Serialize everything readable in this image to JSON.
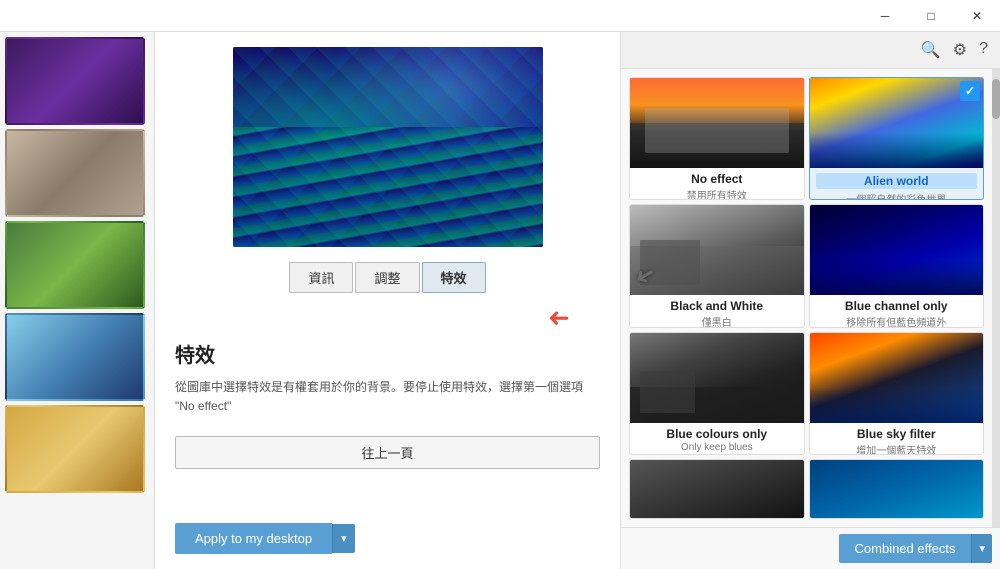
{
  "titlebar": {
    "minimize_label": "─",
    "maximize_label": "□",
    "close_label": "✕"
  },
  "toolbar": {
    "search_icon": "🔍",
    "gear_icon": "⚙",
    "help_icon": "?"
  },
  "sidebar": {
    "thumbs": [
      {
        "id": "thumb1",
        "label": "Thumbnail 1"
      },
      {
        "id": "thumb2",
        "label": "Thumbnail 2"
      },
      {
        "id": "thumb3",
        "label": "Thumbnail 3"
      },
      {
        "id": "thumb4",
        "label": "Thumbnail 4"
      },
      {
        "id": "thumb5",
        "label": "Thumbnail 5"
      }
    ]
  },
  "tabs": [
    {
      "id": "info",
      "label": "資訊"
    },
    {
      "id": "adjust",
      "label": "調整"
    },
    {
      "id": "effects",
      "label": "特效",
      "active": true
    }
  ],
  "section": {
    "title": "特效",
    "description": "從圖庫中選擇特效是有權套用於你的背景。要停止使用特效，選擇第一個選項 \"No effect\"",
    "back_button": "往上一頁"
  },
  "apply_button": {
    "label": "Apply to my desktop",
    "dropdown_icon": "▾"
  },
  "effects": [
    {
      "id": "no-effect",
      "name": "No effect",
      "desc": "禁用所有特效",
      "selected": false,
      "checked": false,
      "thumb_class": "et-noeffect"
    },
    {
      "id": "alien-world",
      "name": "Alien world",
      "desc": "一個超自然的彩色世界",
      "selected": true,
      "checked": true,
      "thumb_class": "et-alien"
    },
    {
      "id": "black-and-white",
      "name": "Black and White",
      "desc": "僅黑白",
      "selected": false,
      "checked": false,
      "thumb_class": "et-bw",
      "has_arrow": true
    },
    {
      "id": "blue-channel-only",
      "name": "Blue channel only",
      "desc": "移除所有但藍色頻道外",
      "selected": false,
      "checked": false,
      "thumb_class": "et-bluechannel"
    },
    {
      "id": "blue-colours-only",
      "name": "Blue colours only",
      "desc": "Only keep blues",
      "selected": false,
      "checked": false,
      "thumb_class": "et-bluecolours"
    },
    {
      "id": "blue-sky-filter",
      "name": "Blue sky filter",
      "desc": "增加一個藍天特效",
      "selected": false,
      "checked": false,
      "thumb_class": "et-bluesky"
    },
    {
      "id": "partial1",
      "name": "",
      "desc": "",
      "selected": false,
      "checked": false,
      "thumb_class": "et-partial1"
    },
    {
      "id": "partial2",
      "name": "",
      "desc": "",
      "selected": false,
      "checked": false,
      "thumb_class": "et-partial2"
    }
  ],
  "combined_button": {
    "label": "Combined effects",
    "dropdown_icon": "▾"
  }
}
